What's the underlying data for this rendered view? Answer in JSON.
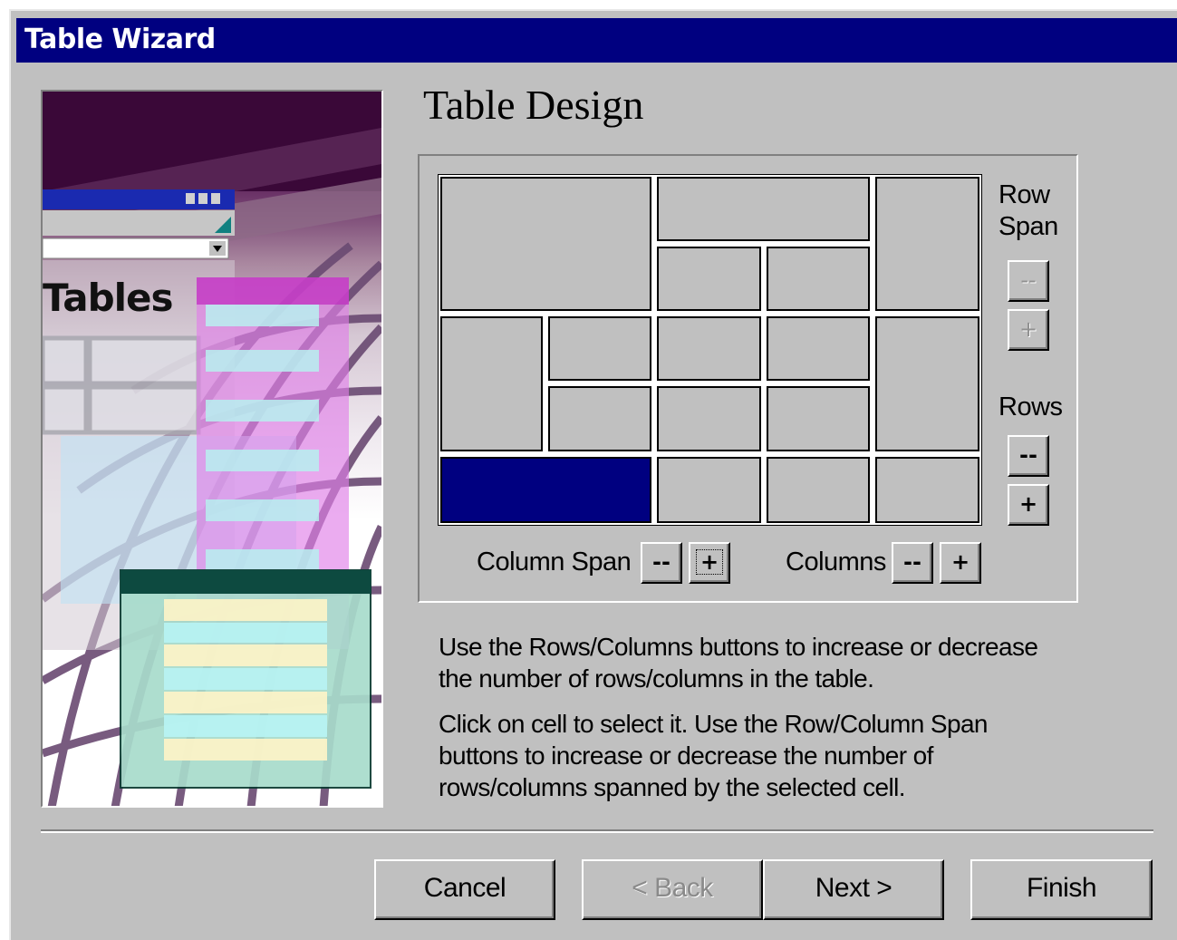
{
  "window": {
    "title": "Table Wizard"
  },
  "illustration": {
    "caption": "Tables"
  },
  "page": {
    "heading": "Table Design"
  },
  "span_controls": {
    "row_span_label_line1": "Row",
    "row_span_label_line2": "Span",
    "row_span_decrease": "--",
    "row_span_increase": "+",
    "rows_label": "Rows",
    "rows_decrease": "--",
    "rows_increase": "+",
    "column_span_label": "Column Span",
    "column_span_decrease": "--",
    "column_span_increase": "+",
    "columns_label": "Columns",
    "columns_decrease": "--",
    "columns_increase": "+"
  },
  "table_preview": {
    "columns": 5,
    "rows": 5,
    "selected_cell": {
      "row": 5,
      "col": 1,
      "col_span": 2,
      "row_span": 1
    }
  },
  "help": {
    "para1_line1": "Use the Rows/Columns buttons to increase or decrease",
    "para1_line2": "the  number of rows/columns in the table.",
    "para2_line1": "Click on cell to select it. Use the Row/Column Span",
    "para2_line2": "buttons to increase or decrease the number of",
    "para2_line3": "rows/columns spanned by the selected cell."
  },
  "buttons": {
    "cancel": "Cancel",
    "back": "< Back",
    "next": "Next >",
    "finish": "Finish"
  },
  "colors": {
    "titlebar": "#000080",
    "face": "#c0c0c0",
    "selected_cell": "#000080"
  }
}
